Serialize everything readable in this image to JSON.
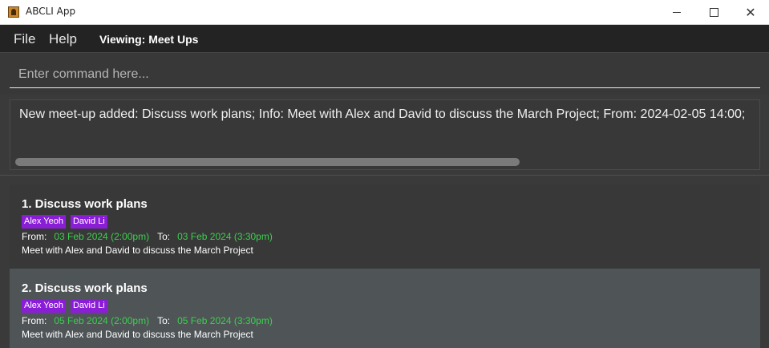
{
  "window": {
    "title": "ABCLI App",
    "icon": "app-icon",
    "controls": [
      "minimize-icon",
      "maximize-icon",
      "close-icon"
    ]
  },
  "menubar": {
    "file_label": "File",
    "help_label": "Help",
    "viewing_label": "Viewing: Meet Ups"
  },
  "command": {
    "value": "",
    "placeholder": "Enter command here..."
  },
  "result": {
    "text": "New meet-up added: Discuss work plans; Info: Meet with Alex and David to discuss the March Project; From: 2024-02-05 14:00;"
  },
  "meetups": [
    {
      "title": "1. Discuss work plans",
      "tags": [
        "Alex Yeoh",
        "David Li"
      ],
      "from_label": "From:",
      "from": "03 Feb 2024 (2:00pm)",
      "to_label": "To:",
      "to": "03 Feb 2024 (3:30pm)",
      "info": "Meet with Alex and David to discuss the March Project"
    },
    {
      "title": "2. Discuss work plans",
      "tags": [
        "Alex Yeoh",
        "David Li"
      ],
      "from_label": "From:",
      "from": "05 Feb 2024 (2:00pm)",
      "to_label": "To:",
      "to": "05 Feb 2024 (3:30pm)",
      "info": "Meet with Alex and David to discuss the March Project"
    }
  ],
  "colors": {
    "tag_bg": "#8a1ed6",
    "time_value": "#3ccf4e",
    "selected_card_bg": "#4f5457"
  }
}
